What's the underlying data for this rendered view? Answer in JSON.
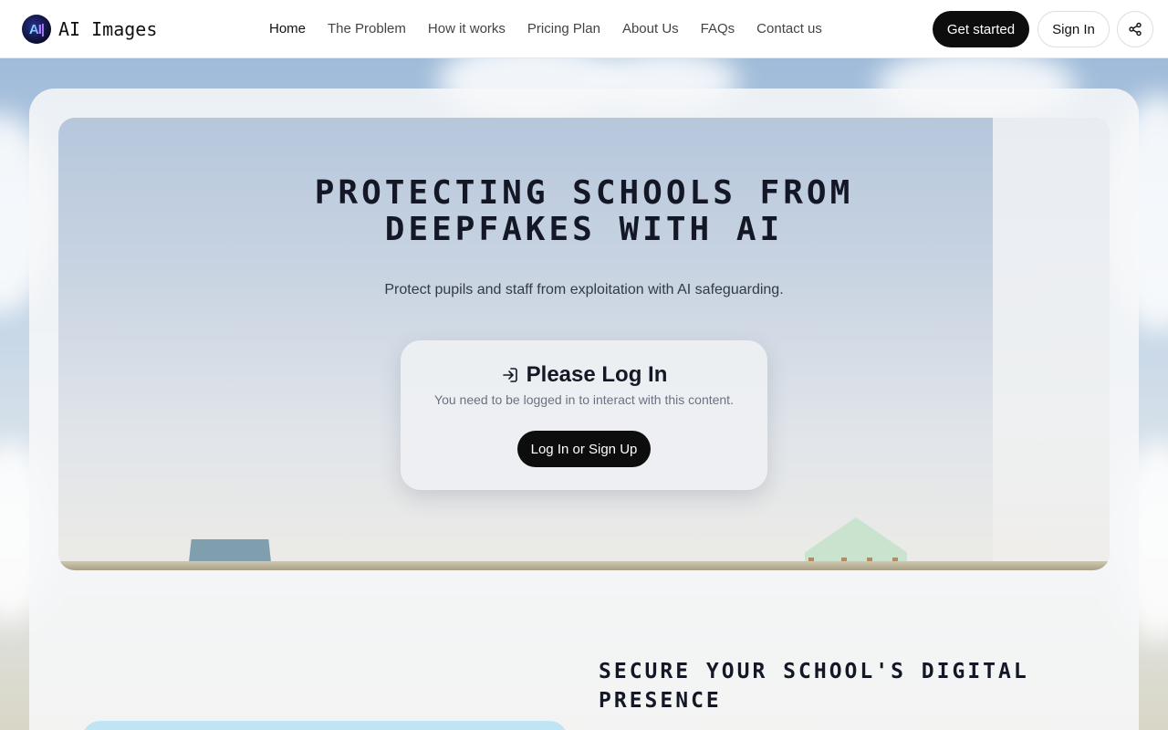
{
  "brand": {
    "logo_text": "AI|",
    "name": "AI Images"
  },
  "nav": {
    "items": [
      {
        "label": "Home",
        "active": true
      },
      {
        "label": "The Problem"
      },
      {
        "label": "How it works"
      },
      {
        "label": "Pricing Plan"
      },
      {
        "label": "About Us"
      },
      {
        "label": "FAQs"
      },
      {
        "label": "Contact us"
      }
    ]
  },
  "header_actions": {
    "get_started": "Get started",
    "sign_in": "Sign In",
    "share_icon": "share-icon"
  },
  "hero": {
    "title_line1": "PROTECTING SCHOOLS FROM",
    "title_line2": "DEEPFAKES WITH AI",
    "subtitle": "Protect pupils and staff from exploitation with AI safeguarding."
  },
  "login_card": {
    "icon": "login-icon",
    "title": "Please Log In",
    "description": "You need to be logged in to interact with this content.",
    "button": "Log In or Sign Up"
  },
  "section": {
    "title_line1": "SECURE YOUR SCHOOL'S DIGITAL",
    "title_line2": "PRESENCE"
  },
  "colors": {
    "accent_dark": "#0d0d0d",
    "text": "#141826",
    "muted": "#6b7280"
  }
}
